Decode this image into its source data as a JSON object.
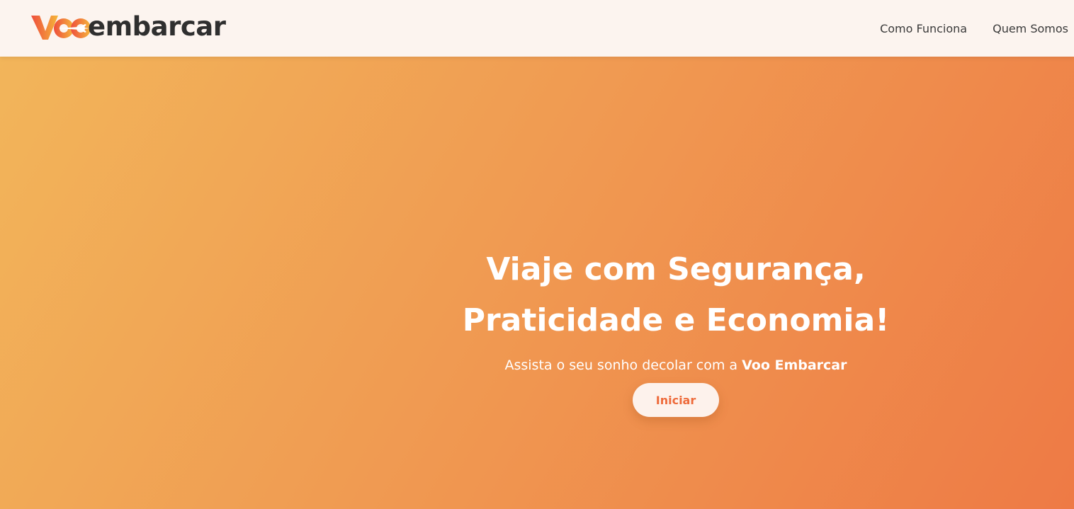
{
  "logo": {
    "brand_text": "embarcar",
    "mark_text": "Voo",
    "mark_icon": "airplane-icon",
    "colors": {
      "primary": "#ee4d3d",
      "secondary": "#f5b63a",
      "text": "#2f2f2f"
    }
  },
  "nav": {
    "items": [
      {
        "label": "Como Funciona"
      },
      {
        "label": "Quem Somos"
      }
    ]
  },
  "hero": {
    "title_line1": "Viaje com Segurança,",
    "title_line2": "Praticidade e Economia!",
    "subtitle_prefix": "Assista o seu sonho decolar com a ",
    "subtitle_brand": "Voo Embarcar",
    "cta_label": "Iniciar",
    "colors": {
      "gradient_start": "#f2b55a",
      "gradient_end": "#ee7a45",
      "button_bg": "#fdf2ec",
      "button_text": "#ee6b3b"
    }
  }
}
